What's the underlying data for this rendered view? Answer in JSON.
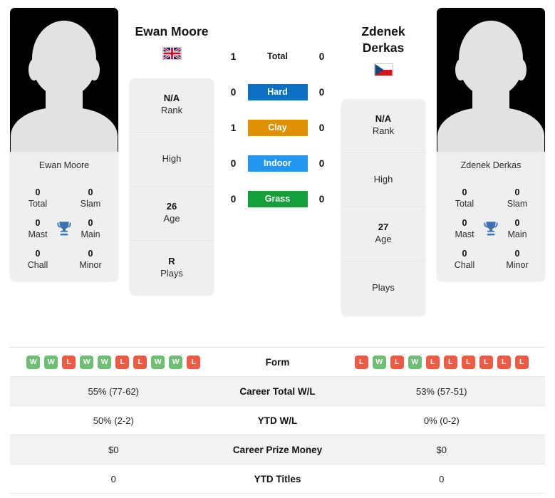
{
  "players": {
    "left": {
      "name": "Ewan Moore",
      "photo_label": "Ewan Moore",
      "flag_country": "gb",
      "flag_name": "united-kingdom-flag",
      "titles": {
        "total_value": "0",
        "total_label": "Total",
        "slam_value": "0",
        "slam_label": "Slam",
        "mast_value": "0",
        "mast_label": "Mast",
        "main_value": "0",
        "main_label": "Main",
        "chall_value": "0",
        "chall_label": "Chall",
        "minor_value": "0",
        "minor_label": "Minor"
      },
      "info": [
        {
          "value": "N/A",
          "label": "Rank"
        },
        {
          "value": "",
          "label": "High"
        },
        {
          "value": "26",
          "label": "Age"
        },
        {
          "value": "R",
          "label": "Plays"
        }
      ]
    },
    "right": {
      "name": "Zdenek Derkas",
      "photo_label": "Zdenek Derkas",
      "flag_country": "cz",
      "flag_name": "czech-republic-flag",
      "titles": {
        "total_value": "0",
        "total_label": "Total",
        "slam_value": "0",
        "slam_label": "Slam",
        "mast_value": "0",
        "mast_label": "Mast",
        "main_value": "0",
        "main_label": "Main",
        "chall_value": "0",
        "chall_label": "Chall",
        "minor_value": "0",
        "minor_label": "Minor"
      },
      "info": [
        {
          "value": "N/A",
          "label": "Rank"
        },
        {
          "value": "",
          "label": "High"
        },
        {
          "value": "27",
          "label": "Age"
        },
        {
          "value": "",
          "label": "Plays"
        }
      ]
    }
  },
  "head_to_head": [
    {
      "surface": "Total",
      "left": "1",
      "right": "0",
      "color": "",
      "badge": false
    },
    {
      "surface": "Hard",
      "left": "0",
      "right": "0",
      "color": "#0b6fc4",
      "badge": true
    },
    {
      "surface": "Clay",
      "left": "1",
      "right": "0",
      "color": "#e09000",
      "badge": true
    },
    {
      "surface": "Indoor",
      "left": "0",
      "right": "0",
      "color": "#2196f3",
      "badge": true
    },
    {
      "surface": "Grass",
      "left": "0",
      "right": "0",
      "color": "#13a03c",
      "badge": true
    }
  ],
  "stats_table": {
    "form_label": "Form",
    "form_left": [
      "W",
      "W",
      "L",
      "W",
      "W",
      "L",
      "L",
      "W",
      "W",
      "L"
    ],
    "form_right": [
      "L",
      "W",
      "L",
      "W",
      "L",
      "L",
      "L",
      "L",
      "L",
      "L"
    ],
    "rows": [
      {
        "label": "Career Total W/L",
        "left": "55% (77-62)",
        "right": "53% (57-51)"
      },
      {
        "label": "YTD W/L",
        "left": "50% (2-2)",
        "right": "0% (0-2)"
      },
      {
        "label": "Career Prize Money",
        "left": "$0",
        "right": "$0"
      },
      {
        "label": "YTD Titles",
        "left": "0",
        "right": "0"
      }
    ]
  },
  "colors": {
    "win_badge": "#6cbf73",
    "loss_badge": "#ef5a43",
    "trophy": "#3f72b0",
    "card_bg": "#efefef"
  }
}
